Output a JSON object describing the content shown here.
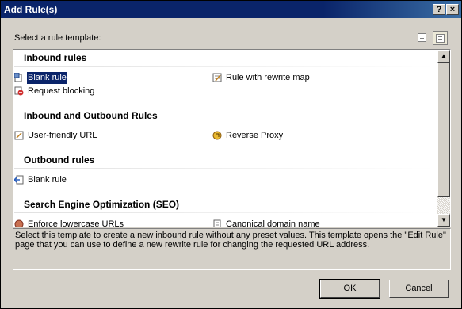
{
  "window": {
    "title": "Add Rule(s)",
    "help_glyph": "?",
    "close_glyph": "×"
  },
  "label": "Select a rule template:",
  "groups": [
    {
      "title": "Inbound rules"
    },
    {
      "title": "Inbound and Outbound Rules"
    },
    {
      "title": "Outbound rules"
    },
    {
      "title": "Search Engine Optimization (SEO)"
    }
  ],
  "items": {
    "inbound_blank": {
      "label": "Blank rule",
      "icon": "blank-rule-icon",
      "selected": true
    },
    "rewrite_map": {
      "label": "Rule with rewrite map",
      "icon": "rewrite-map-icon"
    },
    "request_blocking": {
      "label": "Request blocking",
      "icon": "request-blocking-icon"
    },
    "user_friendly": {
      "label": "User-friendly URL",
      "icon": "user-friendly-url-icon"
    },
    "reverse_proxy": {
      "label": "Reverse Proxy",
      "icon": "reverse-proxy-icon"
    },
    "outbound_blank": {
      "label": "Blank rule",
      "icon": "outbound-blank-rule-icon"
    },
    "lowercase": {
      "label": "Enforce lowercase URLs",
      "icon": "lowercase-icon"
    },
    "canonical": {
      "label": "Canonical domain name",
      "icon": "canonical-domain-icon"
    }
  },
  "description": "Select this template to create a new inbound rule without any preset values. This template opens the \"Edit Rule\" page that you can use to define a new rewrite rule for changing the requested URL address.",
  "buttons": {
    "ok": "OK",
    "cancel": "Cancel"
  },
  "scroll": {
    "up": "▲",
    "down": "▼"
  },
  "colors": {
    "selection": "#0a246a",
    "titlebar": "#0a246a",
    "face": "#d4d0c8"
  }
}
